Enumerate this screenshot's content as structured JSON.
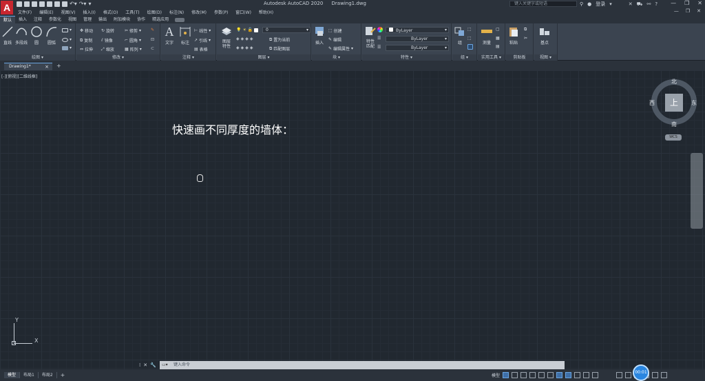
{
  "app": {
    "logo_letter": "A",
    "title": "Autodesk AutoCAD 2020",
    "document": "Drawing1.dwg",
    "search_placeholder": "键入关键字或短语",
    "sign_in": "登录"
  },
  "menu": [
    "文件(F)",
    "编辑(E)",
    "视图(V)",
    "插入(I)",
    "格式(O)",
    "工具(T)",
    "绘图(D)",
    "标注(N)",
    "修改(M)",
    "参数(P)",
    "窗口(W)",
    "帮助(H)"
  ],
  "ribbon_tabs": [
    "默认",
    "插入",
    "注释",
    "参数化",
    "视图",
    "管理",
    "输出",
    "附加模块",
    "协作",
    "精选应用"
  ],
  "ribbon": {
    "draw": {
      "label": "绘图 ▾",
      "line": "直线",
      "polyline": "多段线",
      "circle": "圆",
      "arc": "圆弧"
    },
    "modify": {
      "label": "修改 ▾",
      "move": "移动",
      "rotate": "旋转",
      "trim": "修剪",
      "copy": "复制",
      "mirror": "镜像",
      "fillet": "圆角",
      "stretch": "拉伸",
      "scale": "缩放",
      "array": "阵列"
    },
    "annotation": {
      "label": "注释 ▾",
      "text": "文字",
      "dimension": "标注",
      "linear": "线性",
      "leader": "引线",
      "table": "表格"
    },
    "layers": {
      "label": "图层 ▾",
      "layer_props": "图层\n特性",
      "current_layer": "0",
      "make_current": "置为当前",
      "match_layer": "匹配图层"
    },
    "block": {
      "label": "块 ▾",
      "insert": "插入",
      "create": "创建",
      "edit": "编辑",
      "edit_attr": "编辑属性"
    },
    "properties": {
      "label": "特性 ▾",
      "match": "特性\n匹配",
      "color": "ByLayer",
      "linetype": "ByLayer",
      "lineweight": "ByLayer"
    },
    "groups": {
      "label": "组 ▾",
      "group": "组"
    },
    "utilities": {
      "label": "实用工具 ▾",
      "measure": "测量"
    },
    "clipboard": {
      "label": "剪贴板",
      "paste": "粘贴"
    },
    "view": {
      "label": "视图 ▾",
      "base": "基点"
    }
  },
  "file_tab": {
    "name": "Drawing1*",
    "close": "×",
    "add": "+"
  },
  "canvas": {
    "view_label": "[-][俯视][二维线框]",
    "note_text": "快速画不同厚度的墙体："
  },
  "viewcube": {
    "top": "上",
    "north": "北",
    "south": "南",
    "east": "东",
    "west": "西",
    "wcs": "WCS"
  },
  "ucs": {
    "x": "X",
    "y": "Y"
  },
  "command": {
    "placeholder": "键入命令"
  },
  "layouts": [
    "模型",
    "布局1",
    "布局2"
  ],
  "layout_add": "+",
  "status": {
    "model_label": "模型",
    "timer": "00:01"
  }
}
